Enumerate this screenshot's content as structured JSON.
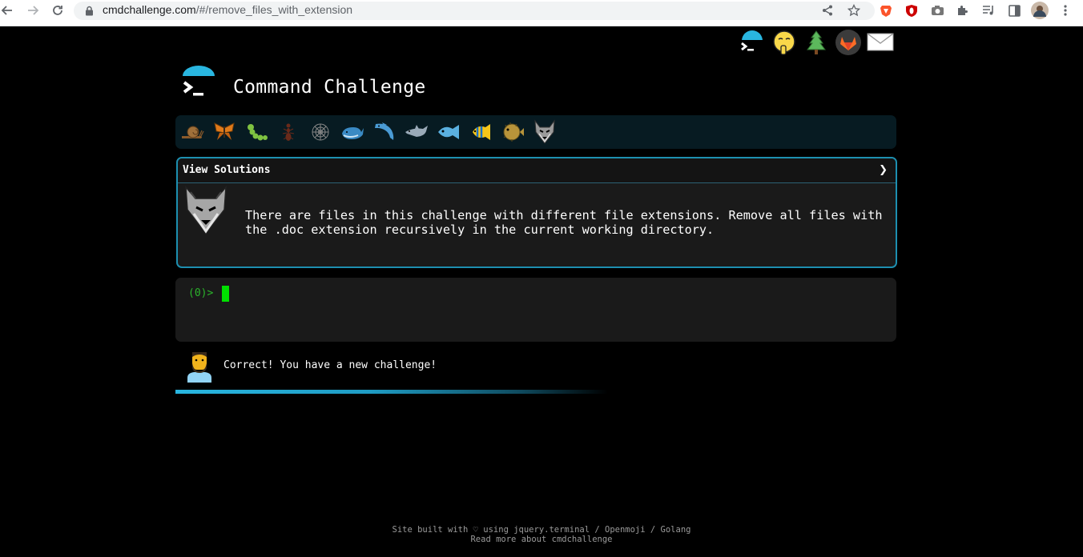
{
  "browser": {
    "url_host": "cmdchallenge.com",
    "url_path": "/#/remove_files_with_extension"
  },
  "header_icons": [
    "cmdchallenge-logo-icon",
    "shushing-face-icon",
    "evergreen-tree-icon",
    "gitlab-icon",
    "envelope-icon"
  ],
  "site": {
    "title": "Command Challenge"
  },
  "progress_animals": [
    "snail",
    "butterfly",
    "caterpillar",
    "ant",
    "spider-web",
    "whale",
    "dolphin",
    "dolphin",
    "fish",
    "tropical-fish",
    "blowfish",
    "wolf"
  ],
  "challenge": {
    "view_solutions_label": "View Solutions",
    "expand_glyph": "❯",
    "description": "There are files in this challenge with different file extensions. Remove all files with the .doc extension recursively in the current working directory."
  },
  "terminal": {
    "prompt": "(0)>"
  },
  "feedback": {
    "message": "Correct! You have a new challenge!"
  },
  "footer": {
    "line1": "Site built with ♡ using jquery.terminal / Openmoji / Golang",
    "line2": "Read more about cmdchallenge"
  },
  "colors": {
    "accent": "#1d8fb0",
    "prompt_green": "#2bb52b",
    "cursor": "#00e000",
    "background": "#000000"
  }
}
